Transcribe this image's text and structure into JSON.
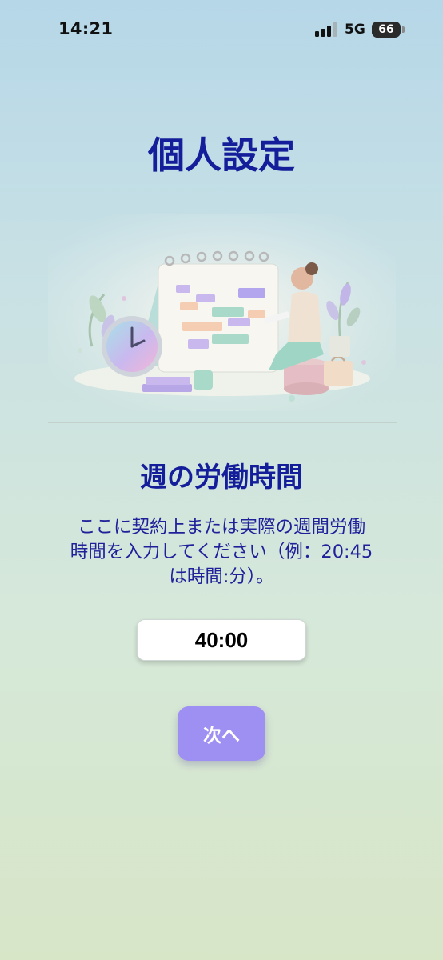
{
  "status_bar": {
    "time": "14:21",
    "network": "5G",
    "battery_level": "66",
    "battery_fraction": 0.66,
    "signal_bars_active": 3,
    "signal_bars_total": 4
  },
  "page_title": "個人設定",
  "illustration_icon": "calendar-planning-illustration",
  "section": {
    "title": "週の労働時間",
    "description_lines": [
      "ここに契約上または実際の週間労働",
      "時間を入力してください（例：20:45",
      "は時間:分）。"
    ]
  },
  "hours_input": {
    "value": "40:00"
  },
  "next_button": {
    "label": "次へ"
  },
  "colors": {
    "title": "#141e9a",
    "button": "#9e8ff2"
  }
}
